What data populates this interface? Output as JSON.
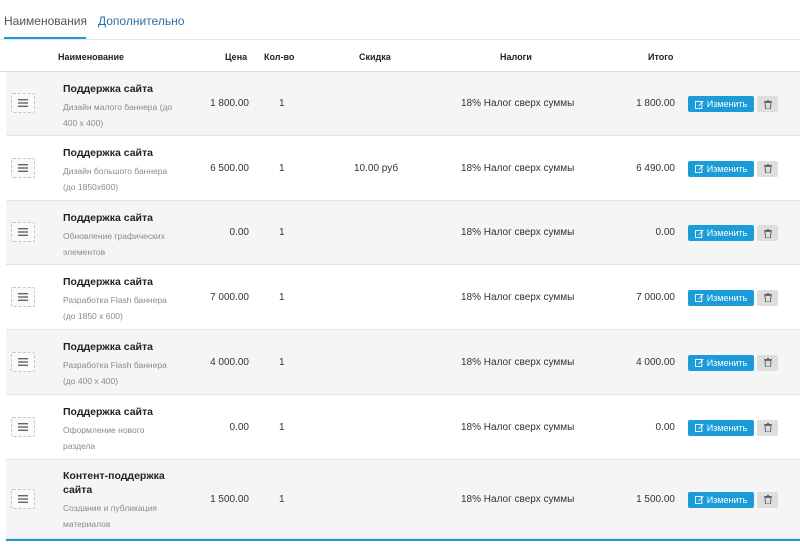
{
  "tabs": [
    {
      "label": "Наименования",
      "active": true
    },
    {
      "label": "Дополнительно",
      "active": false
    }
  ],
  "columns": {
    "name": "Наименование",
    "price": "Цена",
    "qty": "Кол-во",
    "discount": "Скидка",
    "tax": "Налоги",
    "total": "Итого"
  },
  "rows": [
    {
      "name": "Поддержка сайта",
      "desc": "Дизайн малого баннера (до 400 х 400)",
      "price": "1 800.00",
      "qty": "1",
      "discount": "",
      "tax": "18% Налог сверх суммы",
      "total": "1 800.00"
    },
    {
      "name": "Поддержка сайта",
      "desc": "Дизайн большого баннера (до 1850x600)",
      "price": "6 500.00",
      "qty": "1",
      "discount": "10.00 руб",
      "tax": "18% Налог сверх суммы",
      "total": "6 490.00"
    },
    {
      "name": "Поддержка сайта",
      "desc": "Обновление графических элементов",
      "price": "0.00",
      "qty": "1",
      "discount": "",
      "tax": "18% Налог сверх суммы",
      "total": "0.00"
    },
    {
      "name": "Поддержка сайта",
      "desc": "Разработка Flash баннера (до 1850 х 600)",
      "price": "7 000.00",
      "qty": "1",
      "discount": "",
      "tax": "18% Налог сверх суммы",
      "total": "7 000.00"
    },
    {
      "name": "Поддержка сайта",
      "desc": "Разработка Flash баннера (до 400 х 400)",
      "price": "4 000.00",
      "qty": "1",
      "discount": "",
      "tax": "18% Налог сверх суммы",
      "total": "4 000.00"
    },
    {
      "name": "Поддержка сайта",
      "desc": "Оформление нового раздела",
      "price": "0.00",
      "qty": "1",
      "discount": "",
      "tax": "18% Налог сверх суммы",
      "total": "0.00"
    },
    {
      "name": "Контент-поддержка сайта",
      "desc": "Создание и публикация материалов",
      "price": "1 500.00",
      "qty": "1",
      "discount": "",
      "tax": "18% Налог сверх суммы",
      "total": "1 500.00"
    }
  ],
  "actions": {
    "edit_label": "Изменить",
    "edit_icon": "edit-icon",
    "delete_icon": "trash-icon",
    "drag_icon": "drag-handle-icon"
  },
  "colors": {
    "accent": "#1b9cd8",
    "row_alt": "#f5f5f5"
  }
}
